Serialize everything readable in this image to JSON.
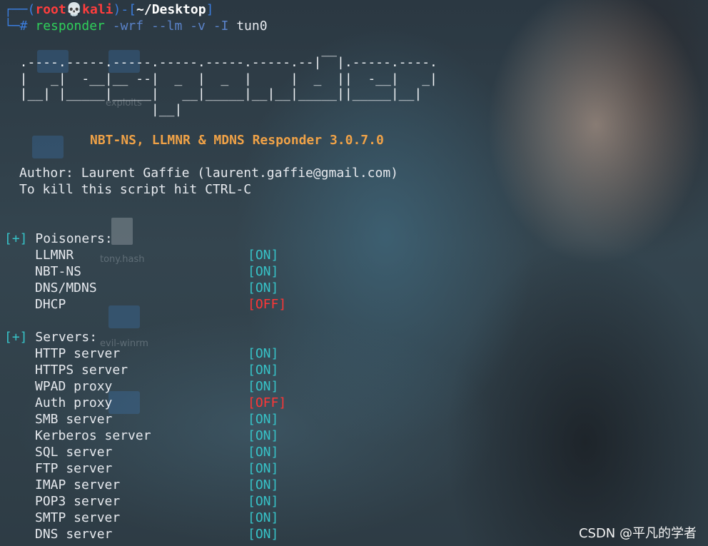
{
  "prompt": {
    "user": "root",
    "skull": "💀",
    "host": "kali",
    "path": "~/Desktop",
    "open_paren": "┌──(",
    "close_paren": ")-[",
    "close_bracket": "]",
    "hash": "└─#"
  },
  "command": {
    "program": "responder",
    "args": [
      "-wrf",
      "--lm",
      "-v",
      "-I"
    ],
    "interface": "tun0"
  },
  "ascii_art": [
    "                                         __",
    "  .----.-----.-----.-----.-----.-----.--|  |.-----.----.",
    "  |   _|  -__|__ --|  _  |  _  |     |  _  ||  -__|   _|",
    "  |__| |_____|_____|   __|_____|__|__|_____||_____|__|",
    "                   |__|"
  ],
  "banner": "NBT-NS, LLMNR & MDNS Responder 3.0.7.0",
  "author_line": "Author: Laurent Gaffie (laurent.gaffie@gmail.com)",
  "kill_line": "To kill this script hit CTRL-C",
  "poisoners": {
    "marker": "[+]",
    "heading": "Poisoners:",
    "items": [
      {
        "name": "LLMNR",
        "status": "[ON]",
        "on": true
      },
      {
        "name": "NBT-NS",
        "status": "[ON]",
        "on": true
      },
      {
        "name": "DNS/MDNS",
        "status": "[ON]",
        "on": true
      },
      {
        "name": "DHCP",
        "status": "[OFF]",
        "on": false
      }
    ]
  },
  "servers": {
    "marker": "[+]",
    "heading": "Servers:",
    "items": [
      {
        "name": "HTTP server",
        "status": "[ON]",
        "on": true
      },
      {
        "name": "HTTPS server",
        "status": "[ON]",
        "on": true
      },
      {
        "name": "WPAD proxy",
        "status": "[ON]",
        "on": true
      },
      {
        "name": "Auth proxy",
        "status": "[OFF]",
        "on": false
      },
      {
        "name": "SMB server",
        "status": "[ON]",
        "on": true
      },
      {
        "name": "Kerberos server",
        "status": "[ON]",
        "on": true
      },
      {
        "name": "SQL server",
        "status": "[ON]",
        "on": true
      },
      {
        "name": "FTP server",
        "status": "[ON]",
        "on": true
      },
      {
        "name": "IMAP server",
        "status": "[ON]",
        "on": true
      },
      {
        "name": "POP3 server",
        "status": "[ON]",
        "on": true
      },
      {
        "name": "SMTP server",
        "status": "[ON]",
        "on": true
      },
      {
        "name": "DNS server",
        "status": "[ON]",
        "on": true
      }
    ]
  },
  "desktop": {
    "labels": [
      "tony.hash",
      "evil-winrm",
      "exploits"
    ]
  },
  "watermark": "CSDN @平凡的学者",
  "colors": {
    "on": "#37c3c8",
    "off": "#ff3636",
    "banner": "#f0a247",
    "prompt_blue": "#3b7ddd",
    "prompt_red": "#ff3d3d"
  }
}
